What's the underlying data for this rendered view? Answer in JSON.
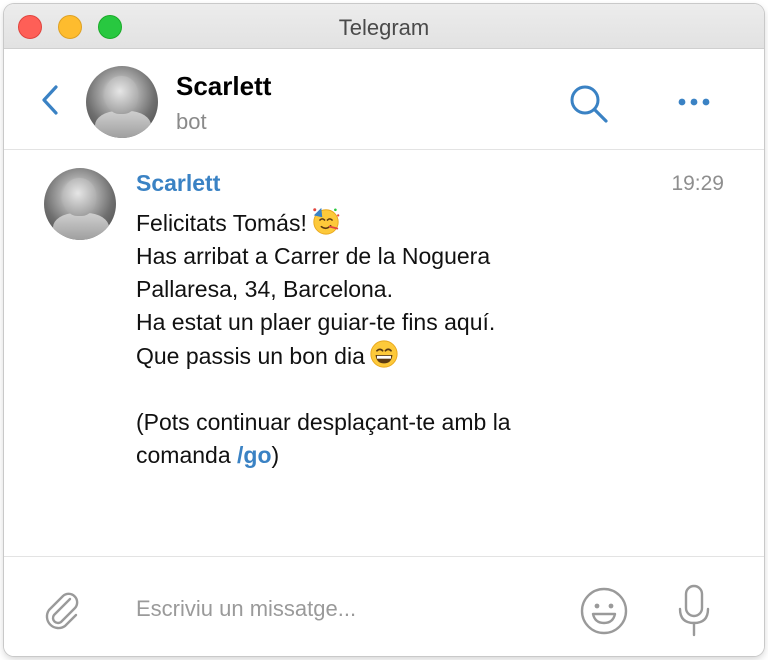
{
  "window": {
    "title": "Telegram"
  },
  "header": {
    "name": "Scarlett",
    "subtitle": "bot"
  },
  "message": {
    "sender": "Scarlett",
    "time": "19:29",
    "line1": "Felicitats Tomás!",
    "line2": "Has arribat a Carrer de la Noguera",
    "line3": "Pallaresa, 34, Barcelona.",
    "line4": "Ha estat un plaer guiar-te fins aquí.",
    "line5": "Que passis un bon dia",
    "line6": "(Pots continuar desplaçant-te amb la",
    "line7_prefix": "comanda",
    "command": "/go",
    "line7_suffix": ")",
    "emoji1": "partying-face-emoji",
    "emoji2": "grinning-face-emoji"
  },
  "composer": {
    "placeholder": "Escriviu un missatge..."
  },
  "icons": {
    "back": "chevron-left-icon",
    "search": "search-icon",
    "more": "more-dots-icon",
    "attach": "paperclip-icon",
    "emoji": "smiley-icon",
    "mic": "microphone-icon"
  },
  "colors": {
    "accent": "#3a82c4",
    "muted": "#8e8e8e",
    "titlebar": "#e6e6e6"
  }
}
